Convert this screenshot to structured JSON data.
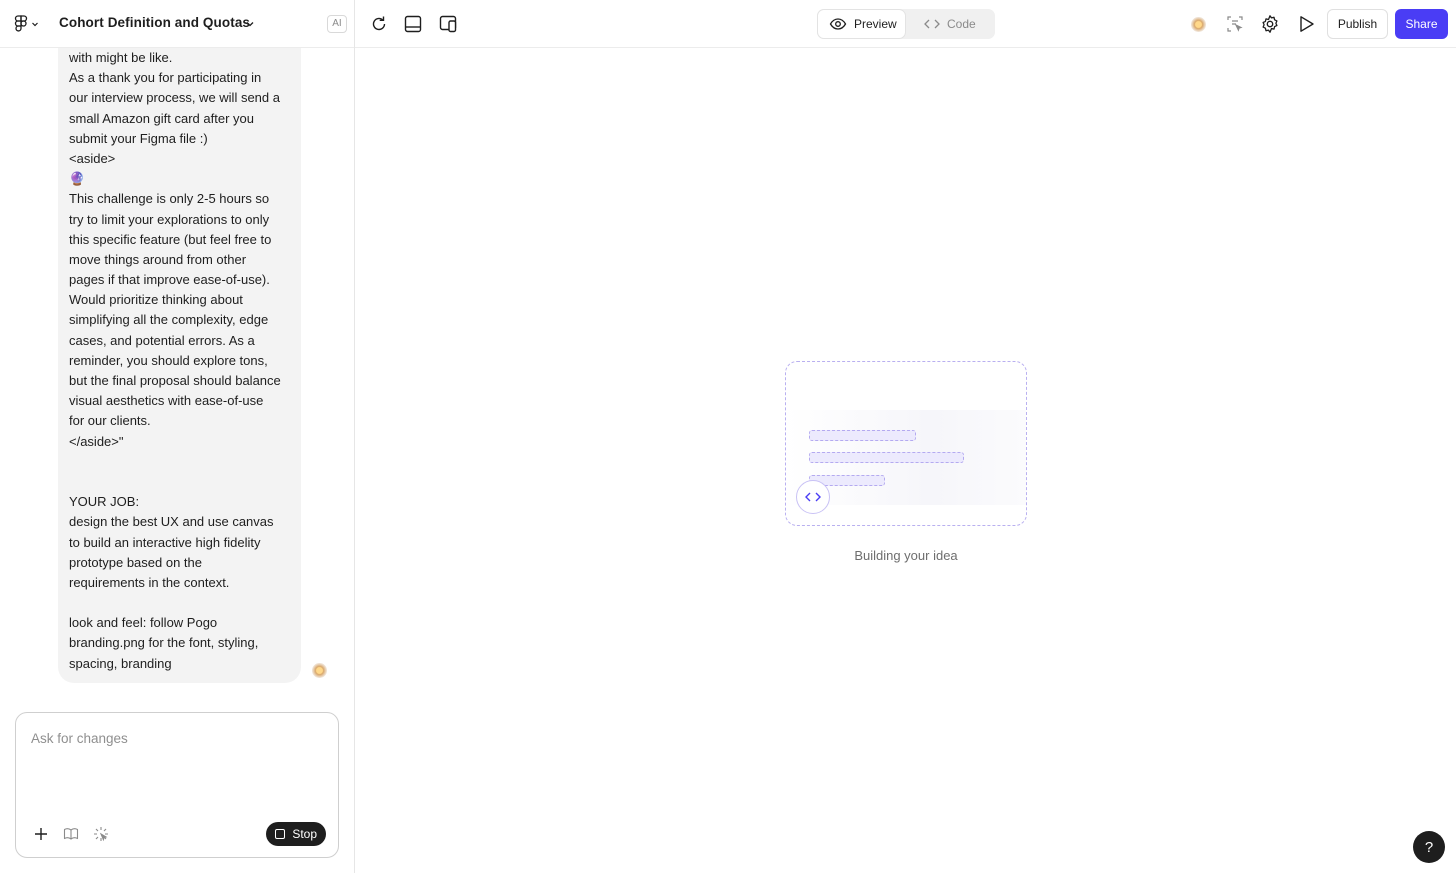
{
  "header": {
    "project_title": "Cohort Definition and Quotas",
    "ai_badge": "AI"
  },
  "chat": {
    "message_lines": [
      "with might be like.",
      "As a thank you for participating in",
      "our interview process, we will send a",
      "small Amazon gift card after you",
      "submit your Figma file :)",
      "<aside>",
      "🔮",
      "This challenge is only 2-5 hours so",
      "try to limit your explorations to only",
      "this specific feature (but feel free to",
      "move things around from other",
      "pages if that improve ease-of-use).",
      "Would prioritize thinking about",
      "simplifying all the complexity, edge",
      "cases, and potential errors. As a",
      "reminder, you should explore tons,",
      "but the final proposal should balance",
      "visual aesthetics with ease-of-use",
      "for our clients.",
      "</aside>\"",
      "",
      "",
      "YOUR JOB:",
      "design the best UX and use canvas",
      "to build an interactive high fidelity",
      "prototype based on the",
      "requirements in the context.",
      "",
      "look and feel: follow Pogo",
      "branding.png for the font, styling,",
      "spacing, branding"
    ]
  },
  "composer": {
    "placeholder": "Ask for changes",
    "stop_label": "Stop"
  },
  "toolbar": {
    "preview_label": "Preview",
    "code_label": "Code",
    "publish_label": "Publish",
    "share_label": "Share"
  },
  "canvas": {
    "status_text": "Building your idea",
    "help_label": "?"
  },
  "colors": {
    "accent": "#4a3df5",
    "dark": "#1e1e1e",
    "dashed_border": "#b9b0f0"
  },
  "icons": {
    "logo": "figma-logo-icon",
    "refresh": "refresh-icon",
    "layout": "panel-layout-icon",
    "responsive": "responsive-view-icon",
    "eye": "eye-icon",
    "code": "code-brackets-icon",
    "inspect": "inspect-icon",
    "settings": "gear-icon",
    "play": "play-icon",
    "plus": "plus-icon",
    "book": "book-icon",
    "sparkle": "sparkle-cursor-icon"
  }
}
